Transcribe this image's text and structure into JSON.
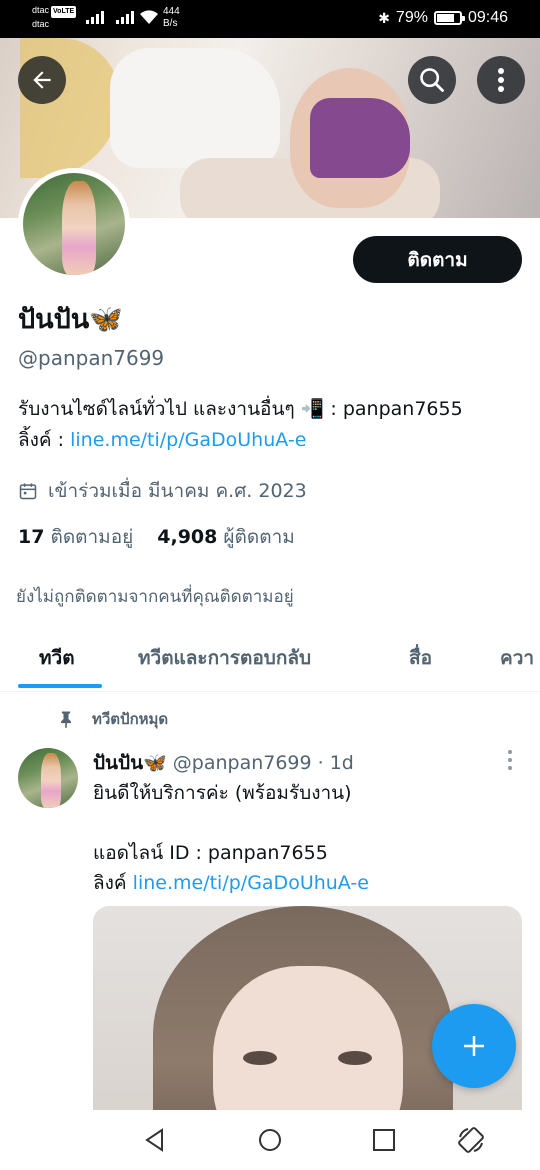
{
  "status_bar": {
    "carrier1": "dtac",
    "volte": "VoLTE",
    "carrier2": "dtac",
    "speed_value": "444",
    "speed_unit": "B/s",
    "battery_percent": "79%",
    "battery_level": 0.79,
    "time": "09:46"
  },
  "profile": {
    "display_name": "ปันปัน🦋",
    "handle": "@panpan7699",
    "bio_line1": "รับงานไซด์ไลน์ทั่วไป และงานอื่นๆ 📲 : panpan7655",
    "bio_link_prefix": "ลิ้งค์ : ",
    "bio_link": "line.me/ti/p/GaDoUhuA-e",
    "joined": "เข้าร่วมเมื่อ มีนาคม ค.ศ. 2023",
    "following_count": "17",
    "following_label": "ติดตามอยู่",
    "followers_count": "4,908",
    "followers_label": "ผู้ติดตาม",
    "not_followed_note": "ยังไม่ถูกติดตามจากคนที่คุณติดตามอยู่",
    "follow_button": "ติดตาม"
  },
  "tabs": [
    {
      "label": "ทวีต",
      "active": true
    },
    {
      "label": "ทวีตและการตอบกลับ",
      "active": false
    },
    {
      "label": "สื่อ",
      "active": false
    },
    {
      "label": "ควา",
      "active": false
    }
  ],
  "tweet": {
    "pinned_label": "ทวีตปักหมุด",
    "author_name": "ปันปัน🦋",
    "author_handle": "@panpan7699",
    "time": "· 1d",
    "line1": "ยินดีให้บริการค่ะ (พร้อมรับงาน)",
    "line2": "แอดไลน์ ID : panpan7655",
    "link_prefix": "ลิงค์ ",
    "link": "line.me/ti/p/GaDoUhuA-e"
  },
  "icons": {
    "back": "arrow-left-icon",
    "search": "search-icon",
    "more": "more-vertical-icon",
    "calendar": "calendar-icon",
    "pin": "pin-icon",
    "compose": "plus-icon"
  },
  "colors": {
    "accent": "#1d9bf0",
    "text": "#0f1419",
    "secondary": "#536471"
  }
}
